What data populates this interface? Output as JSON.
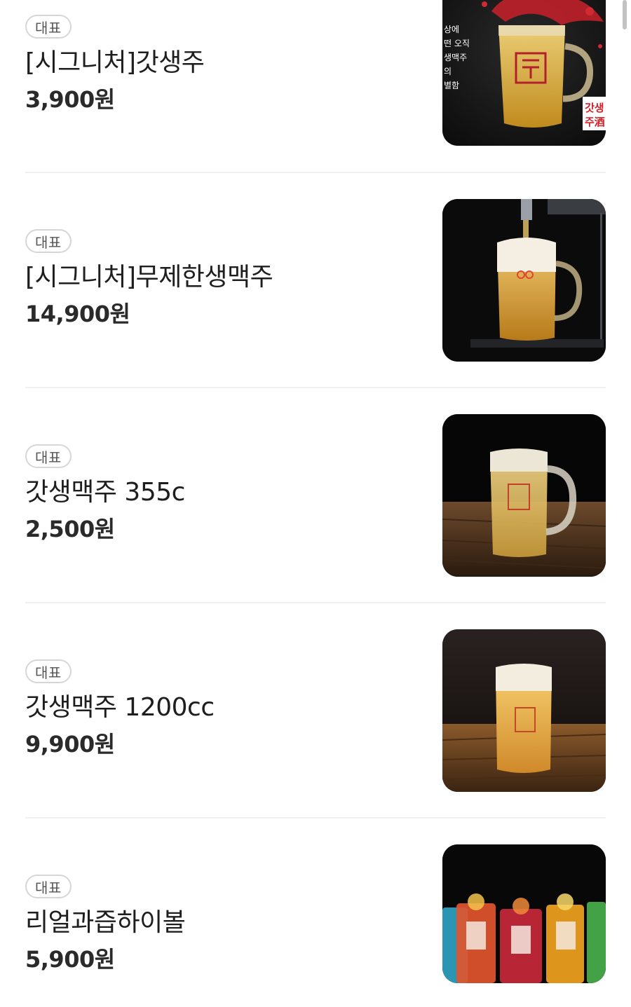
{
  "menu": {
    "items": [
      {
        "badge": "대표",
        "name": "[시그니처]갓생주",
        "price": "3,900원",
        "image_text": [
          "상에",
          "떤 오직",
          "생맥주",
          "의",
          "별함"
        ],
        "image_brand": "갓생\n주酒"
      },
      {
        "badge": "대표",
        "name": "[시그니처]무제한생맥주",
        "price": "14,900원"
      },
      {
        "badge": "대표",
        "name": "갓생맥주 355c",
        "price": "2,500원"
      },
      {
        "badge": "대표",
        "name": "갓생맥주 1200cc",
        "price": "9,900원"
      },
      {
        "badge": "대표",
        "name": "리얼과즙하이볼",
        "price": "5,900원"
      }
    ]
  }
}
